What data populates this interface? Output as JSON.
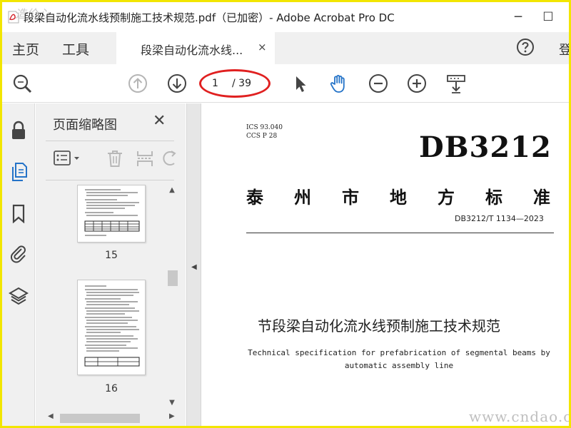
{
  "window": {
    "title": "段梁自动化流水线预制施工技术规范.pdf（已加密）- Adobe Acrobat Pro DC",
    "minimize": "─",
    "maximize": "☐"
  },
  "watermarks": {
    "top": "造价心",
    "bottom": "www.cndao.com"
  },
  "nav": {
    "home": "主页",
    "tools": "工具",
    "login": "登"
  },
  "tab": {
    "label": "段梁自动化流水线...",
    "close": "×"
  },
  "pager": {
    "current": "1",
    "total": "/ 39"
  },
  "panel": {
    "title": "页面缩略图",
    "close": "✕",
    "thumbnails": [
      {
        "label": "15"
      },
      {
        "label": "16"
      }
    ]
  },
  "document": {
    "ics": "ICS 93.040",
    "ccs": "CCS P 28",
    "code": "DB3212",
    "authority_chars": [
      "泰",
      "州",
      "市",
      "地",
      "方",
      "标",
      "准"
    ],
    "standard_no": "DB3212/T 1134—2023",
    "title_cn": "节段梁自动化流水线预制施工技术规范",
    "title_en_line1": "Technical specification for prefabrication of segmental beams by",
    "title_en_line2": "automatic assembly line"
  },
  "colors": {
    "frame": "#f2e600",
    "accent_blue": "#2473c8",
    "annotation_red": "#e02020",
    "panel_bg": "#f0f0f0"
  },
  "icons": {
    "toolbar": [
      "search-zoom-icon",
      "page-up-icon",
      "page-down-icon",
      "select-cursor-icon",
      "hand-icon",
      "zoom-out-icon",
      "zoom-in-icon",
      "fit-page-icon"
    ],
    "rail": [
      "lock-icon",
      "page-thumbnails-icon",
      "bookmark-icon",
      "attachment-icon",
      "layers-icon"
    ]
  }
}
